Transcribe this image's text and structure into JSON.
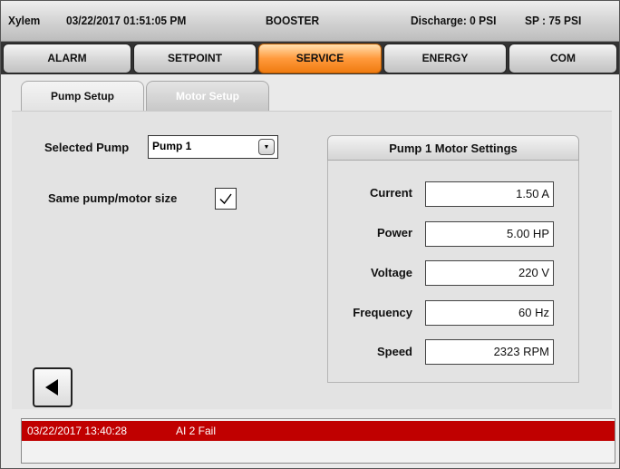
{
  "header": {
    "brand": "Xylem",
    "datetime": "03/22/2017 01:51:05 PM",
    "mode": "BOOSTER",
    "discharge": "Discharge: 0 PSI",
    "setpoint": "SP : 75 PSI"
  },
  "nav": {
    "tabs": [
      {
        "label": "ALARM"
      },
      {
        "label": "SETPOINT"
      },
      {
        "label": "SERVICE",
        "active": true
      },
      {
        "label": "ENERGY"
      },
      {
        "label": "COM"
      }
    ]
  },
  "subtabs": {
    "pump_setup": "Pump Setup",
    "motor_setup": "Motor Setup"
  },
  "left": {
    "selected_pump_label": "Selected Pump",
    "selected_pump_value": "Pump 1",
    "same_size_label": "Same pump/motor size",
    "same_size_checked": true
  },
  "motor": {
    "title": "Pump 1  Motor Settings",
    "fields": [
      {
        "label": "Current",
        "value": "1.50 A"
      },
      {
        "label": "Power",
        "value": "5.00 HP"
      },
      {
        "label": "Voltage",
        "value": "220 V"
      },
      {
        "label": "Frequency",
        "value": "60 Hz"
      },
      {
        "label": "Speed",
        "value": "2323 RPM"
      }
    ]
  },
  "alarm": {
    "timestamp": "03/22/2017 13:40:28",
    "message": "AI 2 Fail"
  },
  "colors": {
    "active_tab": "#f07b10",
    "alarm_row": "#c00000"
  },
  "icons": {
    "back": "back-arrow-icon",
    "dropdown": "chevron-down-icon",
    "check": "checkmark-icon"
  }
}
